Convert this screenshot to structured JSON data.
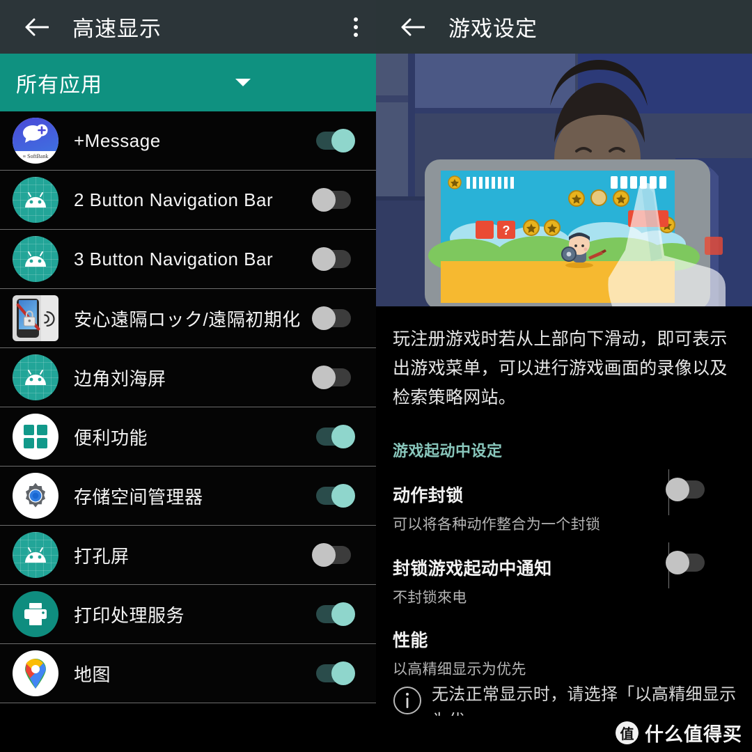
{
  "left_pane": {
    "header": {
      "back_icon": "back-arrow-icon",
      "title": "高速显示",
      "overflow_icon": "overflow-menu-icon"
    },
    "spinner": {
      "label": "所有应用",
      "caret_icon": "chevron-down-icon"
    },
    "apps": [
      {
        "name": "+Message",
        "icon": "plus-message-icon",
        "state": "on"
      },
      {
        "name": "2 Button Navigation Bar",
        "icon": "android-droid-icon",
        "state": "off"
      },
      {
        "name": "3 Button Navigation Bar",
        "icon": "android-droid-icon",
        "state": "off"
      },
      {
        "name": "安心遠隔ロック/遠隔初期化",
        "icon": "remote-lock-icon",
        "state": "off"
      },
      {
        "name": "边角刘海屏",
        "icon": "android-droid-icon",
        "state": "off"
      },
      {
        "name": "便利功能",
        "icon": "grid-squares-icon",
        "state": "on"
      },
      {
        "name": "存储空间管理器",
        "icon": "gear-icon",
        "state": "on"
      },
      {
        "name": "打孔屏",
        "icon": "android-droid-icon",
        "state": "off"
      },
      {
        "name": "打印处理服务",
        "icon": "printer-icon",
        "state": "on"
      },
      {
        "name": "地图",
        "icon": "maps-pin-icon",
        "state": "on"
      }
    ]
  },
  "right_pane": {
    "header": {
      "back_icon": "back-arrow-icon",
      "title": "游戏设定"
    },
    "hero": {
      "alt": "illustration-person-playing-game-on-tablet"
    },
    "description": "玩注册游戏时若从上部向下滑动，即可表示出游戏菜单，可以进行游戏画面的录像以及检索策略网站。",
    "section_title": "游戏起动中设定",
    "preferences": [
      {
        "title": "动作封锁",
        "subtitle": "可以将各种动作整合为一个封锁",
        "state": "off"
      },
      {
        "title": "封锁游戏起动中通知",
        "subtitle": "不封锁來电",
        "state": "off"
      }
    ],
    "performance": {
      "title": "性能",
      "subtitle": "以高精细显示为优先",
      "info_icon": "info-circle-icon",
      "info_text": "无法正常显示时，请选择「以高精细显示为优"
    }
  },
  "watermark": {
    "badge": "值",
    "text": "什么值得买"
  },
  "colors": {
    "accent_teal": "#0f9180",
    "toggle_on_thumb": "#8fd6cc",
    "toggle_on_track": "#2a4c4b",
    "toggle_off_thumb": "#c3c3c3",
    "toggle_off_track": "#3c3c3c",
    "appbar": "#2c3539",
    "section_head": "#89c7bc"
  }
}
